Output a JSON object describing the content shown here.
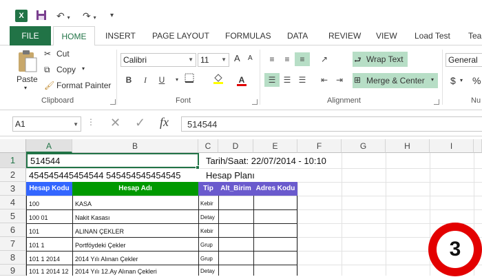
{
  "qat": {
    "app_icon": "X",
    "save_icon": "save-icon",
    "undo_icon": "undo-icon",
    "redo_icon": "redo-icon",
    "customize_icon": "customize-icon"
  },
  "tabs": [
    "FILE",
    "HOME",
    "INSERT",
    "PAGE LAYOUT",
    "FORMULAS",
    "DATA",
    "REVIEW",
    "VIEW",
    "Load Test",
    "Tea"
  ],
  "ribbon": {
    "clipboard": {
      "paste": "Paste",
      "cut": "Cut",
      "copy": "Copy",
      "format_painter": "Format Painter",
      "label": "Clipboard"
    },
    "font": {
      "name": "Calibri",
      "size": "11",
      "bold": "B",
      "italic": "I",
      "underline": "U",
      "grow": "A",
      "shrink": "A",
      "label": "Font"
    },
    "alignment": {
      "wrap_text": "Wrap Text",
      "merge_center": "Merge & Center",
      "label": "Alignment"
    },
    "number": {
      "format": "General",
      "currency": "$",
      "percent": "%",
      "label": "Nu"
    }
  },
  "formula_bar": {
    "name_box": "A1",
    "cancel": "✕",
    "enter": "✓",
    "fx": "fx",
    "value": "514544"
  },
  "columns": [
    "A",
    "B",
    "C",
    "D",
    "E",
    "F",
    "G",
    "H",
    "I"
  ],
  "rows": [
    "1",
    "2",
    "3",
    "4",
    "5",
    "6",
    "7",
    "8",
    "9"
  ],
  "cells": {
    "a1": "514544",
    "date": "Tarih/Saat: 22/07/2014 - 10:10",
    "a2": "454545445454544 545454545454545",
    "plan": "Hesap Planı"
  },
  "table_headers": {
    "hesap_kodu": "Hesap Kodu",
    "hesap_adi": "Hesap Adı",
    "tip": "Tip",
    "alt_birim": "Alt_Birim",
    "adres_kodu": "Adres Kodu"
  },
  "table_rows": [
    {
      "kod": "100",
      "ad": "KASA",
      "tip": "Kebir"
    },
    {
      "kod": "100 01",
      "ad": "Nakit Kasası",
      "tip": "Detay"
    },
    {
      "kod": "101",
      "ad": "ALINAN ÇEKLER",
      "tip": "Kebir"
    },
    {
      "kod": "101 1",
      "ad": "Portföydeki Çekler",
      "tip": "Grup"
    },
    {
      "kod": "101 1 2014",
      "ad": "2014 Yılı Alınan Çekler",
      "tip": "Grup"
    },
    {
      "kod": "101 1 2014 12",
      "ad": "2014 Yılı 12.Ay Alınan Çekleri",
      "tip": "Detay"
    }
  ],
  "badge": "3",
  "colors": {
    "excel_green": "#217346",
    "header_blue": "#3366ff",
    "header_green": "#009900",
    "header_purple": "#6a5acd",
    "badge_red": "#e30000"
  }
}
